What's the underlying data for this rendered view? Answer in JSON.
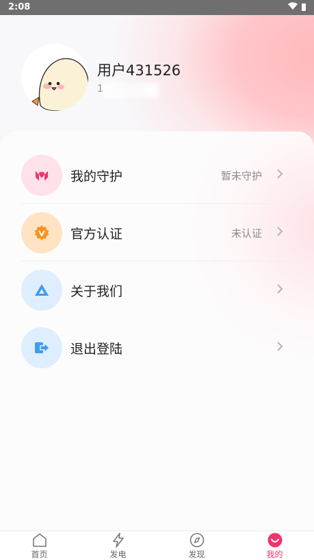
{
  "status_bar": {
    "time": "2:08"
  },
  "profile": {
    "username": "用户431526",
    "user_id_prefix": "1"
  },
  "menu": [
    {
      "label": "我的守护",
      "value": "暂未守护",
      "icon": "heart-hands-icon",
      "icon_bg": "#ffe1ea",
      "icon_color": "#f2336c"
    },
    {
      "label": "官方认证",
      "value": "未认证",
      "icon": "badge-v-icon",
      "icon_bg": "#ffe3c2",
      "icon_color": "#f7921e"
    },
    {
      "label": "关于我们",
      "value": "",
      "icon": "triangle-logo-icon",
      "icon_bg": "#deeefe",
      "icon_color": "#3d9cf0"
    },
    {
      "label": "退出登陆",
      "value": "",
      "icon": "logout-icon",
      "icon_bg": "#deeefe",
      "icon_color": "#3d9cf0"
    }
  ],
  "tabs": [
    {
      "label": "首页",
      "icon": "home-icon"
    },
    {
      "label": "发电",
      "icon": "lightning-icon"
    },
    {
      "label": "发现",
      "icon": "compass-icon"
    },
    {
      "label": "我的",
      "icon": "smile-icon",
      "active": true
    }
  ],
  "colors": {
    "accent": "#f2336c"
  }
}
